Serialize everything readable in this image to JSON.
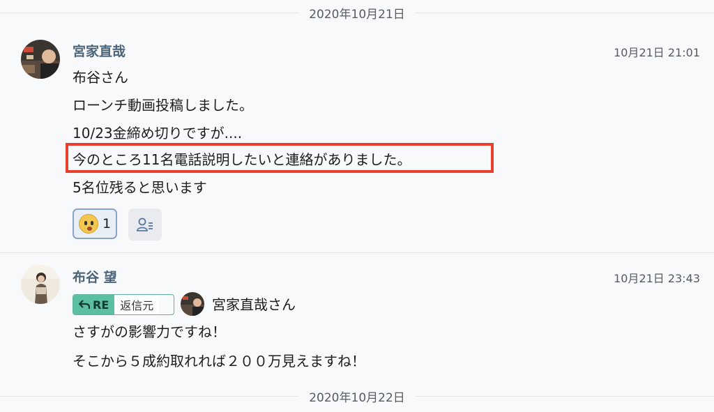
{
  "date_separators": [
    "2020年10月21日",
    "2020年10月22日"
  ],
  "messages": [
    {
      "author": "宮家直哉",
      "time": "10月21日 21:01",
      "lines": [
        "布谷さん",
        "ローンチ動画投稿しました。",
        "10/23金締め切りですが....",
        "今のところ11名電話説明したいと連絡がありました。",
        "5名位残ると思います"
      ],
      "reaction": {
        "icon": "surprised-face-icon",
        "count": "1"
      },
      "add_reaction_icon": "user-list-icon"
    },
    {
      "author": "布谷 望",
      "time": "10月21日 23:43",
      "reply_badge": {
        "re_label": "RE",
        "label": "返信元"
      },
      "reply_to": "宮家直哉さん",
      "lines": [
        "さすがの影響力ですね！",
        "そこから５成約取れれば２００万見えますね！"
      ]
    }
  ],
  "colors": {
    "highlight": "#e8402c",
    "author": "#4a6379",
    "re_badge": "#5cbfa2"
  }
}
